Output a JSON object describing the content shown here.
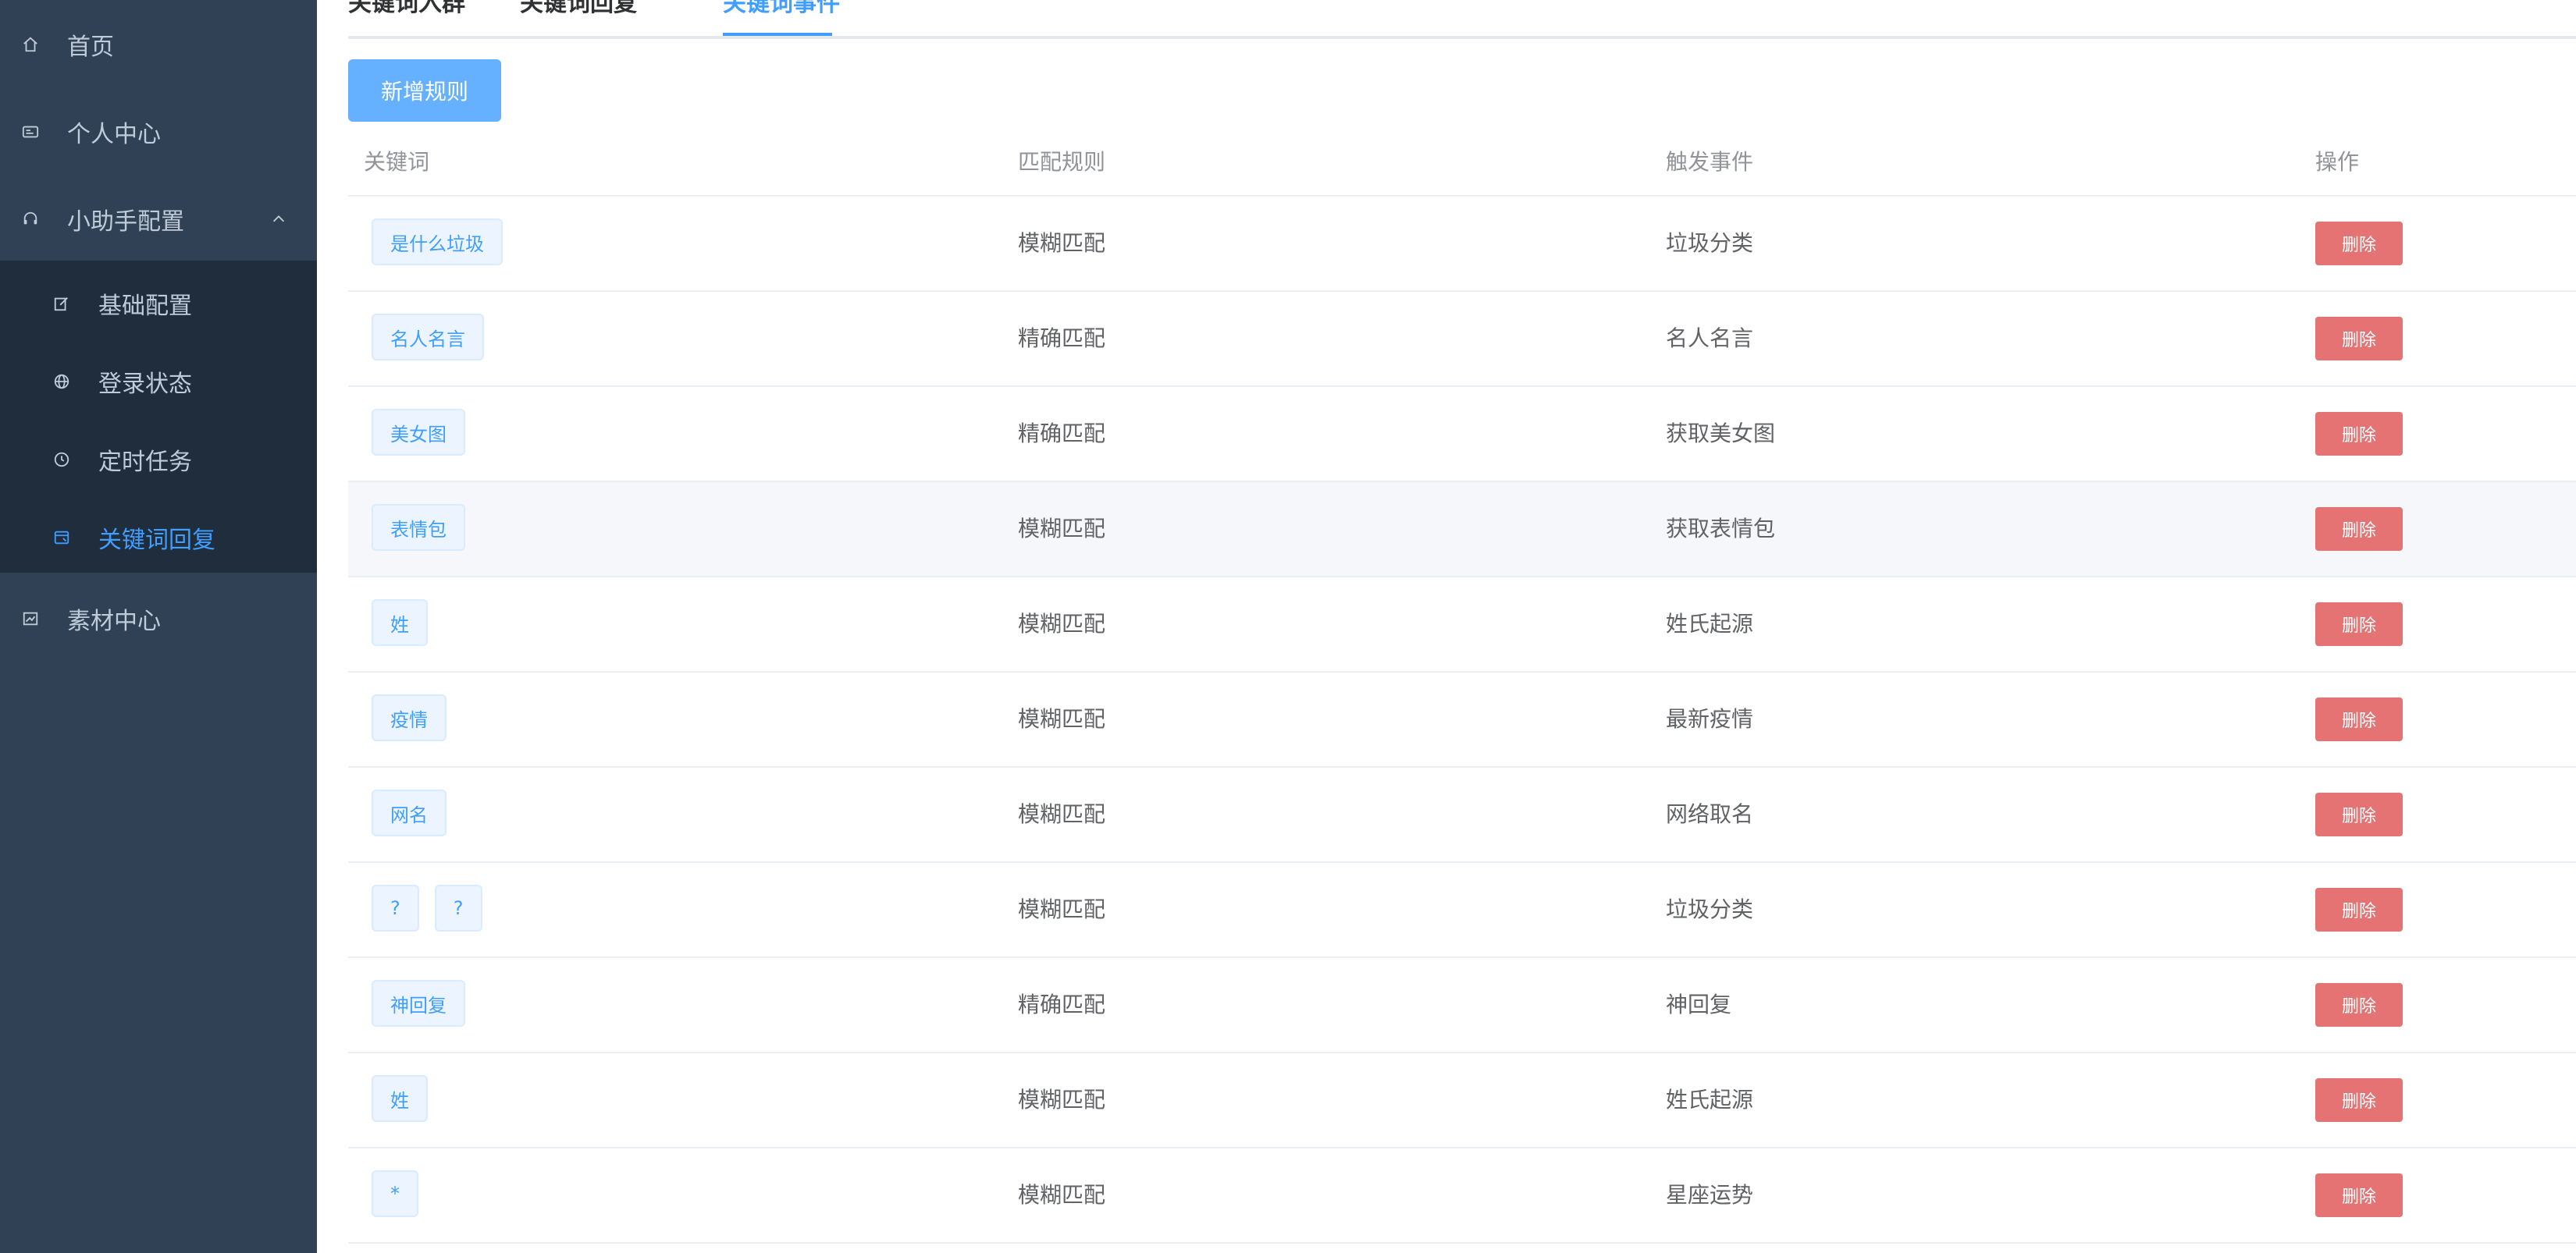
{
  "sidebar": {
    "items": [
      {
        "label": "首页",
        "icon": "home-icon"
      },
      {
        "label": "个人中心",
        "icon": "id-card-icon"
      },
      {
        "label": "小助手配置",
        "icon": "headset-icon",
        "expanded": true
      },
      {
        "label": "素材中心",
        "icon": "picture-icon"
      }
    ],
    "submenu": [
      {
        "label": "基础配置",
        "icon": "edit-icon"
      },
      {
        "label": "登录状态",
        "icon": "globe-icon"
      },
      {
        "label": "定时任务",
        "icon": "clock-icon"
      },
      {
        "label": "关键词回复",
        "icon": "reply-icon",
        "active": true
      }
    ]
  },
  "tabs": [
    {
      "label": "关键词入群"
    },
    {
      "label": "关键词回复"
    },
    {
      "label": "关键词事件",
      "active": true
    }
  ],
  "add_button": "新增规则",
  "table": {
    "headers": [
      "关键词",
      "匹配规则",
      "触发事件",
      "操作"
    ],
    "delete_label": "删除",
    "rows": [
      {
        "keywords": [
          "是什么垃圾"
        ],
        "rule": "模糊匹配",
        "event": "垃圾分类"
      },
      {
        "keywords": [
          "名人名言"
        ],
        "rule": "精确匹配",
        "event": "名人名言"
      },
      {
        "keywords": [
          "美女图"
        ],
        "rule": "精确匹配",
        "event": "获取美女图"
      },
      {
        "keywords": [
          "表情包"
        ],
        "rule": "模糊匹配",
        "event": "获取表情包"
      },
      {
        "keywords": [
          "姓"
        ],
        "rule": "模糊匹配",
        "event": "姓氏起源"
      },
      {
        "keywords": [
          "疫情"
        ],
        "rule": "模糊匹配",
        "event": "最新疫情"
      },
      {
        "keywords": [
          "网名"
        ],
        "rule": "模糊匹配",
        "event": "网络取名"
      },
      {
        "keywords": [
          "?",
          "?"
        ],
        "rule": "模糊匹配",
        "event": "垃圾分类"
      },
      {
        "keywords": [
          "神回复"
        ],
        "rule": "精确匹配",
        "event": "神回复"
      },
      {
        "keywords": [
          "姓"
        ],
        "rule": "模糊匹配",
        "event": "姓氏起源"
      },
      {
        "keywords": [
          "*"
        ],
        "rule": "模糊匹配",
        "event": "星座运势"
      }
    ]
  },
  "colors": {
    "sidebar_bg": "#304156",
    "submenu_bg": "#1f2d3d",
    "accent": "#409eff",
    "danger": "#e57373"
  }
}
